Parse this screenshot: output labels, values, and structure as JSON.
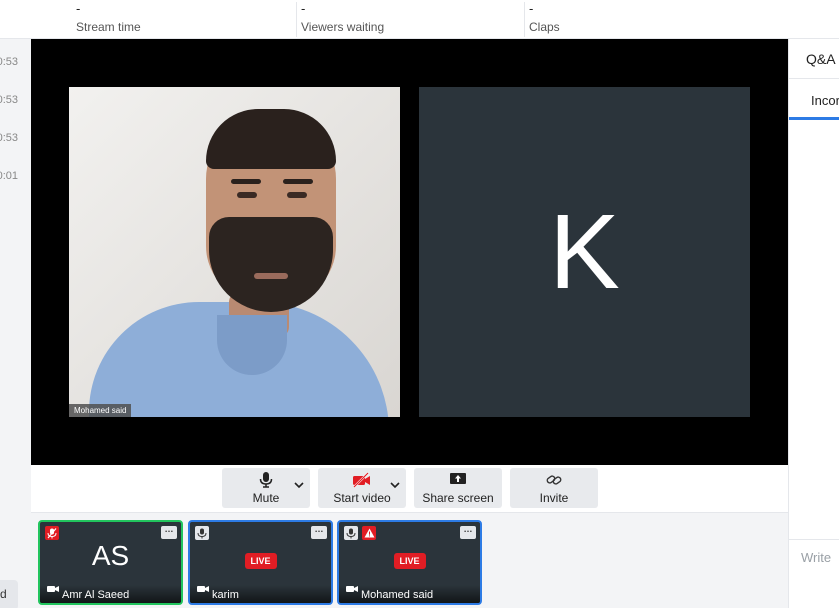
{
  "stats": [
    {
      "value": "-",
      "label": "Stream time"
    },
    {
      "value": "-",
      "label": "Viewers waiting"
    },
    {
      "value": "-",
      "label": "Claps"
    }
  ],
  "timestamps": [
    "0:53",
    "0:53",
    "0:53",
    "0:01"
  ],
  "left_bottom_chip": "d",
  "stage": {
    "video_name_tag": "Mohamed said",
    "avatar_letter": "K"
  },
  "controls": {
    "mute_label": "Mute",
    "start_video_label": "Start video",
    "share_screen_label": "Share screen",
    "invite_label": "Invite"
  },
  "participants": [
    {
      "initials": "AS",
      "name": "Amr Al Saeed",
      "live": ""
    },
    {
      "initials": "",
      "name": "karim",
      "live": "LIVE"
    },
    {
      "initials": "",
      "name": "Mohamed said",
      "live": "LIVE"
    }
  ],
  "right_panel": {
    "tab_label": "Q&A",
    "sub_tab_label": "Incor",
    "write_placeholder": "Write"
  },
  "colors": {
    "accent": "#2d7be5",
    "live_red": "#e11d24",
    "active_speaker": "#22c55e",
    "tile_bg": "#2b343b"
  }
}
